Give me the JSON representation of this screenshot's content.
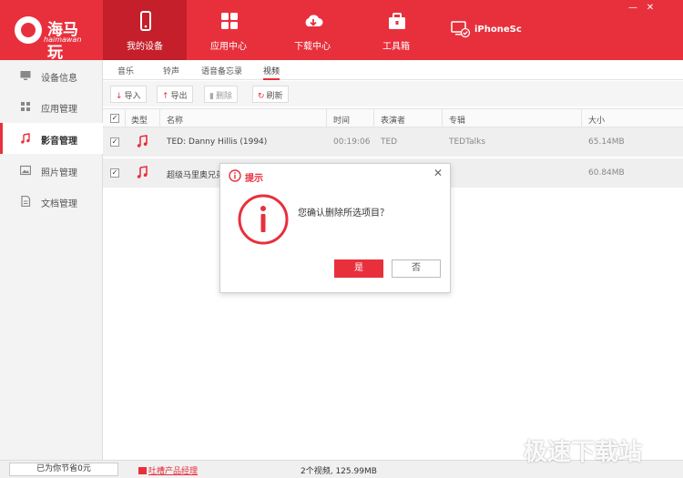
{
  "app": {
    "logo_cn": "海马玩",
    "logo_en": "haimawan",
    "window_controls": {
      "minimize": "—",
      "close": "✕"
    }
  },
  "nav": {
    "items": [
      {
        "label": "我的设备",
        "icon": "phone-icon",
        "active": true
      },
      {
        "label": "应用中心",
        "icon": "apps-grid-icon",
        "active": false
      },
      {
        "label": "下载中心",
        "icon": "cloud-download-icon",
        "active": false
      },
      {
        "label": "工具箱",
        "icon": "toolbox-icon",
        "active": false
      }
    ],
    "device_name": "iPhoneSc"
  },
  "sidebar": {
    "items": [
      {
        "label": "设备信息",
        "icon": "monitor-icon"
      },
      {
        "label": "应用管理",
        "icon": "grid-icon"
      },
      {
        "label": "影音管理",
        "icon": "music-note-icon",
        "active": true
      },
      {
        "label": "照片管理",
        "icon": "image-icon"
      },
      {
        "label": "文档管理",
        "icon": "document-icon"
      }
    ]
  },
  "subtabs": [
    "音乐",
    "铃声",
    "语音备忘录",
    "视频"
  ],
  "active_subtab": "视频",
  "toolbar": {
    "import": "导入",
    "export": "导出",
    "delete": "删除",
    "refresh": "刷新"
  },
  "table": {
    "columns": [
      "类型",
      "名称",
      "时间",
      "表演者",
      "专辑",
      "大小"
    ],
    "rows": [
      {
        "checked": true,
        "name": "TED: Danny Hillis (1994)",
        "time": "00:19:06",
        "artist": "TED",
        "album": "TEDTalks",
        "size": "65.14MB"
      },
      {
        "checked": true,
        "name": "超级马里奥兄弟",
        "time": "",
        "artist": "",
        "album": "",
        "size": "60.84MB"
      }
    ]
  },
  "dialog": {
    "title": "提示",
    "message": "您确认删除所选项目？",
    "yes": "是",
    "no": "否",
    "close": "✕"
  },
  "status": {
    "saved": "已为你节省0元",
    "feedback": "吐槽产品经理",
    "stats": "2个视频, 125.99MB"
  },
  "watermark": "极速下载站",
  "colors": {
    "accent": "#e8303c",
    "accent_dark": "#c41f2a"
  }
}
